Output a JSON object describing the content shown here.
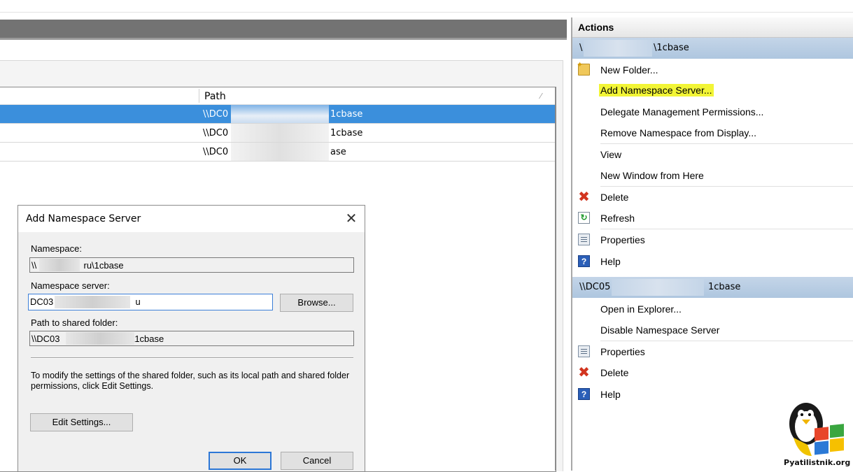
{
  "table": {
    "column_path": "Path",
    "rows": [
      {
        "path_start": "\\\\DC0",
        "path_end": "1cbase",
        "selected": true
      },
      {
        "path_start": "\\\\DC0",
        "path_end": "1cbase",
        "selected": false
      },
      {
        "path_start": "\\\\DC0",
        "path_end": "ase",
        "selected": false
      }
    ]
  },
  "dialog": {
    "title": "Add Namespace Server",
    "namespace_label": "Namespace:",
    "namespace_value_start": "\\\\",
    "namespace_value_end": "ru\\1cbase",
    "server_label": "Namespace server:",
    "server_value_start": "DC03",
    "server_value_end": "u",
    "browse_label": "Browse...",
    "path_label": "Path to shared folder:",
    "path_value_start": "\\\\DC03",
    "path_value_end": "\\1cbase",
    "info_text": "To modify the settings of the shared folder, such as its local path and shared folder permissions, click Edit Settings.",
    "edit_settings_label": "Edit Settings...",
    "ok_label": "OK",
    "cancel_label": "Cancel"
  },
  "actions": {
    "header": "Actions",
    "group1": {
      "title_start": "\\",
      "title_end": "\\1cbase"
    },
    "group1_items": [
      {
        "label": "New Folder...",
        "icon": "new-folder-icon"
      },
      {
        "label": "Add Namespace Server...",
        "highlighted": true
      },
      {
        "label": "Delegate Management Permissions..."
      },
      {
        "label": "Remove Namespace from Display..."
      },
      {
        "label": "View"
      },
      {
        "label": "New Window from Here"
      },
      {
        "label": "Delete",
        "icon": "delete-icon"
      },
      {
        "label": "Refresh",
        "icon": "refresh-icon"
      },
      {
        "label": "Properties",
        "icon": "properties-icon"
      },
      {
        "label": "Help",
        "icon": "help-icon"
      }
    ],
    "group2": {
      "title_start": "\\\\DC05",
      "title_end": "1cbase"
    },
    "group2_items": [
      {
        "label": "Open in Explorer..."
      },
      {
        "label": "Disable Namespace Server"
      },
      {
        "label": "Properties",
        "icon": "properties-icon"
      },
      {
        "label": "Delete",
        "icon": "delete-icon"
      },
      {
        "label": "Help",
        "icon": "help-icon"
      }
    ]
  },
  "watermark": "Pyatilistnik.org",
  "colors": {
    "selection": "#3b8fdc",
    "highlight": "#f2f536",
    "group_header": "#b6cbe2"
  }
}
